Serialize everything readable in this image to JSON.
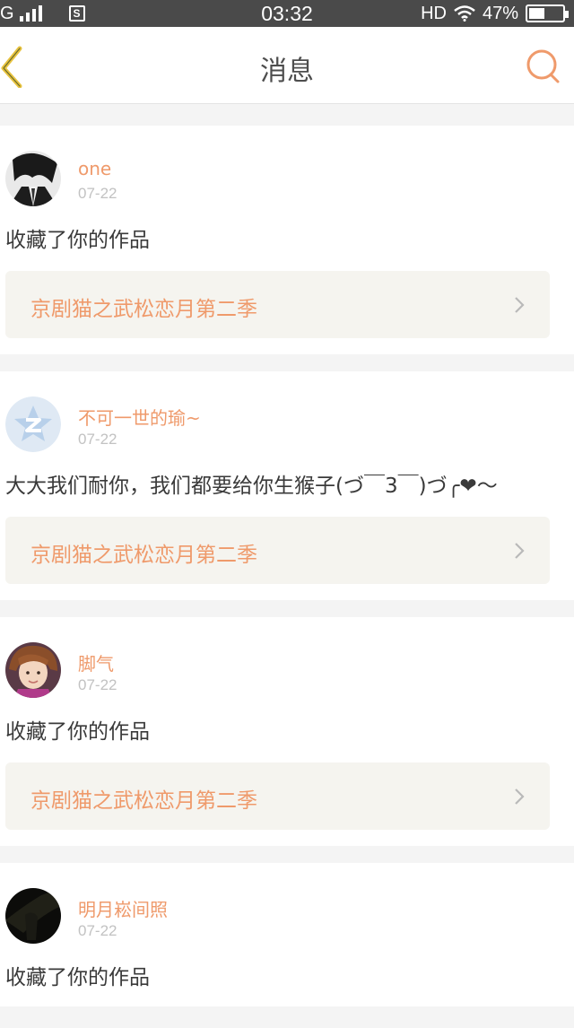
{
  "status_bar": {
    "carrier": "G",
    "time": "03:32",
    "network": "HD",
    "battery": "47%",
    "battery_level": 0.47
  },
  "nav": {
    "title": "消息"
  },
  "colors": {
    "accent": "#ef9a6b",
    "back_icon": "#e8c33f",
    "date": "#c2c2c2"
  },
  "messages": [
    {
      "username": "one",
      "date": "07-22",
      "text": "收藏了你的作品",
      "work_title": "京剧猫之武松恋月第二季",
      "avatar": "dark-hair-avatar"
    },
    {
      "username": "不可一世的瑜~",
      "date": "07-22",
      "text": "大大我们耐你，我们都要给你生猴子(づ￣3￣)づ╭❤～",
      "work_title": "京剧猫之武松恋月第二季",
      "avatar": "default-z-avatar"
    },
    {
      "username": "脚气",
      "date": "07-22",
      "text": "收藏了你的作品",
      "work_title": "京剧猫之武松恋月第二季",
      "avatar": "boy-photo-avatar"
    },
    {
      "username": "明月崧间照",
      "date": "07-22",
      "text": "收藏了你的作品",
      "work_title": "",
      "avatar": "night-scene-avatar"
    }
  ]
}
